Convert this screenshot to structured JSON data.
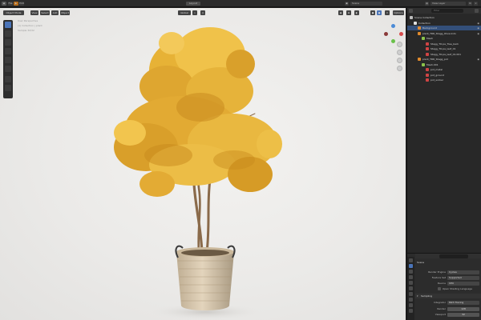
{
  "topbar": {
    "menu": [
      "File",
      "Edit",
      "Render",
      "Window",
      "Help"
    ],
    "workspace_tab": "Layout",
    "scene_name": "Scene",
    "view_layer": "View Layer"
  },
  "viewport": {
    "header": {
      "mode": "Object Mode",
      "menus": [
        "View",
        "Select",
        "Add",
        "Object"
      ],
      "transform": "Global",
      "options": "Options"
    },
    "overlay_lines": [
      "User Perspective",
      "(1) Collection | plant",
      "Sample 32/32"
    ]
  },
  "outliner": {
    "search_placeholder": "Filter",
    "items": [
      {
        "label": "Scene Collection",
        "depth": 0,
        "selected": false,
        "icon_color": "#bdbdbd"
      },
      {
        "label": "Collection",
        "depth": 1,
        "selected": false,
        "icon_color": "#e0e0e0"
      },
      {
        "label": "Background",
        "depth": 2,
        "selected": true,
        "icon_color": "#e08a2c"
      },
      {
        "label": "plant_TRR_Stagg_Olive.Indo",
        "depth": 2,
        "selected": false,
        "icon_color": "#e08a2c"
      },
      {
        "label": "Mesh",
        "depth": 3,
        "selected": false,
        "icon_color": "#8bc34a"
      },
      {
        "label": "Stagg_TO.pa_Tree_bark",
        "depth": 4,
        "selected": false,
        "icon_color": "#d04444"
      },
      {
        "label": "Stagg_TO.pa_leaf_01",
        "depth": 4,
        "selected": false,
        "icon_color": "#d04444"
      },
      {
        "label": "Stagg_TO.pa_leaf_01.001",
        "depth": 4,
        "selected": false,
        "icon_color": "#d04444"
      },
      {
        "label": "plant_TRR_Stagg_pot",
        "depth": 2,
        "selected": false,
        "icon_color": "#e08a2c"
      },
      {
        "label": "Mesh.001",
        "depth": 3,
        "selected": false,
        "icon_color": "#8bc34a"
      },
      {
        "label": "pot_metal",
        "depth": 4,
        "selected": false,
        "icon_color": "#d04444"
      },
      {
        "label": "pot_ground",
        "depth": 4,
        "selected": false,
        "icon_color": "#d04444"
      },
      {
        "label": "pot_wicker",
        "depth": 4,
        "selected": false,
        "icon_color": "#d04444"
      }
    ]
  },
  "properties": {
    "context": "Scene",
    "render_engine_label": "Render Engine",
    "render_engine": "Cycles",
    "feature_set_label": "Feature Set",
    "feature_set": "Supported",
    "device_label": "Device",
    "device": "CPU",
    "osl_label": "Open Shading Language",
    "sampling_header": "Sampling",
    "integrator_label": "Integrator",
    "integrator": "Path Tracing",
    "render_label": "Render",
    "render_samples": "128",
    "viewport_label": "Viewport",
    "viewport_samples": "32"
  },
  "colors": {
    "accent": "#4a74b8",
    "selection": "#334f79",
    "leaf_light": "#f2c34a",
    "leaf_mid": "#e0a62a",
    "leaf_dark": "#c8891c",
    "basket": "#d8c7aa"
  }
}
